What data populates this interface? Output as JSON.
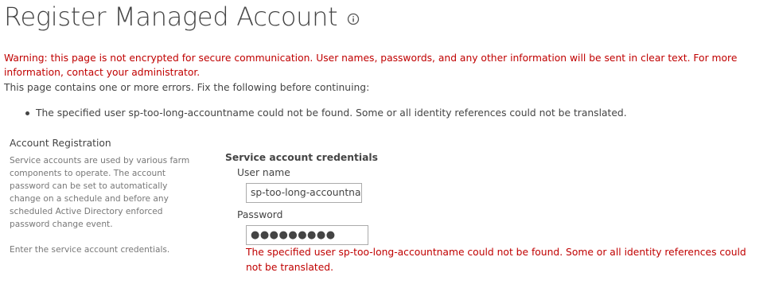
{
  "page": {
    "title": "Register Managed Account",
    "info_icon": "info-icon"
  },
  "warning": {
    "text": "Warning: this page is not encrypted for secure communication. User names, passwords, and any other information will be sent in clear text. For more information, contact your administrator."
  },
  "errors": {
    "intro": "This page contains one or more errors. Fix the following before continuing:",
    "items": [
      "The specified user sp-too-long-accountname could not be found. Some or all identity references could not be translated."
    ]
  },
  "section": {
    "heading": "Account Registration",
    "description": "Service accounts are used by various farm components to operate. The account password can be set to automatically change on a schedule and before any scheduled Active Directory enforced password change event.",
    "instructions": "Enter the service account credentials."
  },
  "credentials": {
    "group_title": "Service account credentials",
    "username_label": "User name",
    "username_value": "sp-too-long-accountname",
    "password_label": "Password",
    "password_value": "●●●●●●●●●",
    "error_text": "The specified user sp-too-long-accountname could not be found. Some or all identity references could not be translated."
  },
  "colors": {
    "error": "#c00000",
    "text": "#444444",
    "muted": "#777777",
    "input_border": "#ababab"
  }
}
